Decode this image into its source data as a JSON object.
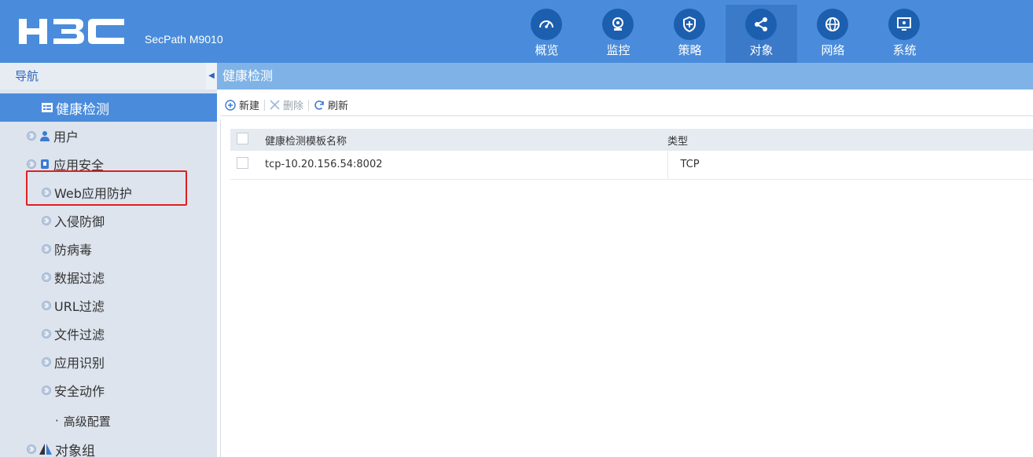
{
  "brand": {
    "logo_text": "H3C",
    "product": "SecPath M9010"
  },
  "top_tabs": [
    {
      "label": "概览",
      "icon": "speedometer-icon"
    },
    {
      "label": "监控",
      "icon": "camera-icon"
    },
    {
      "label": "策略",
      "icon": "shield-plus-icon"
    },
    {
      "label": "对象",
      "icon": "share-nodes-icon",
      "active": true
    },
    {
      "label": "网络",
      "icon": "globe-icon"
    },
    {
      "label": "系统",
      "icon": "monitor-icon"
    }
  ],
  "sidebar": {
    "title": "导航",
    "items": [
      {
        "label": "健康检测",
        "icon": "list-icon",
        "level": 1,
        "active": true
      },
      {
        "label": "用户",
        "icon": "user-icon",
        "level": 0
      },
      {
        "label": "应用安全",
        "icon": "app-security-icon",
        "level": 0
      },
      {
        "label": "Web应用防护",
        "level": 1,
        "highlighted": true
      },
      {
        "label": "入侵防御",
        "level": 1
      },
      {
        "label": "防病毒",
        "level": 1
      },
      {
        "label": "数据过滤",
        "level": 1
      },
      {
        "label": "URL过滤",
        "level": 1
      },
      {
        "label": "文件过滤",
        "level": 1
      },
      {
        "label": "应用识别",
        "level": 1
      },
      {
        "label": "安全动作",
        "level": 1
      },
      {
        "label": "高级配置",
        "level": 2
      },
      {
        "label": "对象组",
        "icon": "object-group-icon",
        "level": 0
      }
    ]
  },
  "breadcrumb": "健康检测",
  "toolbar": {
    "new": "新建",
    "delete": "删除",
    "refresh": "刷新"
  },
  "table": {
    "columns": [
      "健康检测模板名称",
      "类型"
    ],
    "rows": [
      {
        "name": "tcp-10.20.156.54:8002",
        "type": "TCP"
      }
    ]
  },
  "colors": {
    "header": "#4a8cdb",
    "active_tab": "#3b79c9",
    "icon_circle": "#1d5faf",
    "sidebar": "#dde4ee",
    "breadcrumb": "#7fb3e7",
    "highlight": "#e0201e"
  }
}
